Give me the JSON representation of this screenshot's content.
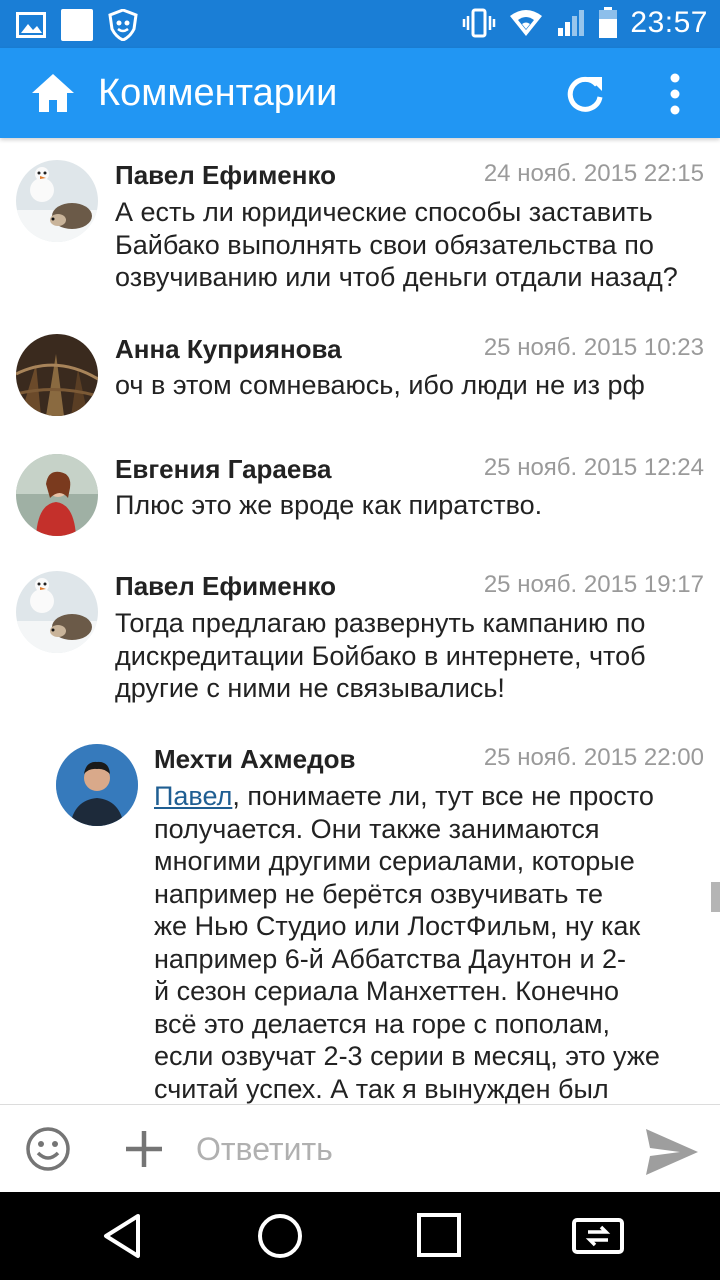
{
  "status_bar": {
    "time": "23:57",
    "icons": [
      "gallery-icon",
      "notification-square-icon",
      "app-shield-icon",
      "vibrate-icon",
      "wifi-icon",
      "signal-icon",
      "battery-icon"
    ]
  },
  "app_bar": {
    "title": "Комментарии",
    "icons": [
      "home-icon",
      "refresh-icon",
      "more-vert-icon"
    ],
    "color": "#2196f3",
    "status_color": "#1a7ed6"
  },
  "comments": [
    {
      "author": "Павел Ефименко",
      "date": "24 нояб. 2015 22:15",
      "lines": [
        "А есть ли юридические способы заставить",
        "Байбако выполнять свои обязательства по",
        "озвучиванию или чтоб деньги отдали назад?"
      ]
    },
    {
      "author": "Анна Куприянова",
      "date": "25 нояб. 2015 10:23",
      "lines": [
        "оч в этом сомневаюсь, ибо люди не из рф"
      ]
    },
    {
      "author": "Евгения Гараева",
      "date": "25 нояб. 2015 12:24",
      "lines": [
        "Плюс это же вроде как пиратство."
      ]
    },
    {
      "author": "Павел Ефименко",
      "date": "25 нояб. 2015 19:17",
      "lines": [
        "Тогда предлагаю развернуть кампанию по",
        "дискредитации Бойбако в интернете, чтоб",
        "другие с ними не связывались!"
      ]
    },
    {
      "author": "Мехти Ахмедов",
      "date": "25 нояб. 2015 22:00",
      "mention": "Павел",
      "first_line_rest": ", понимаете ли, тут все не просто",
      "lines": [
        "получается. Они также занимаются",
        "многими другими сериалами, которые",
        "например не берётся озвучивать те",
        "же Нью Студио или ЛостФильм, ну как",
        "например 6-й Аббатства Даунтон и 2-",
        "й сезон сериала Манхеттен. Конечно",
        "всё это делается на горе с пополам,",
        "если озвучат 2-3 серии в месяц, это уже",
        "считай успех. А так я вынужден был"
      ]
    }
  ],
  "reply_bar": {
    "placeholder": "Ответить",
    "icons": [
      "emoji-icon",
      "plus-icon",
      "send-icon"
    ]
  },
  "nav_bar": {
    "icons": [
      "back-icon",
      "home-circle-icon",
      "recent-apps-icon",
      "screen-switch-icon"
    ]
  }
}
